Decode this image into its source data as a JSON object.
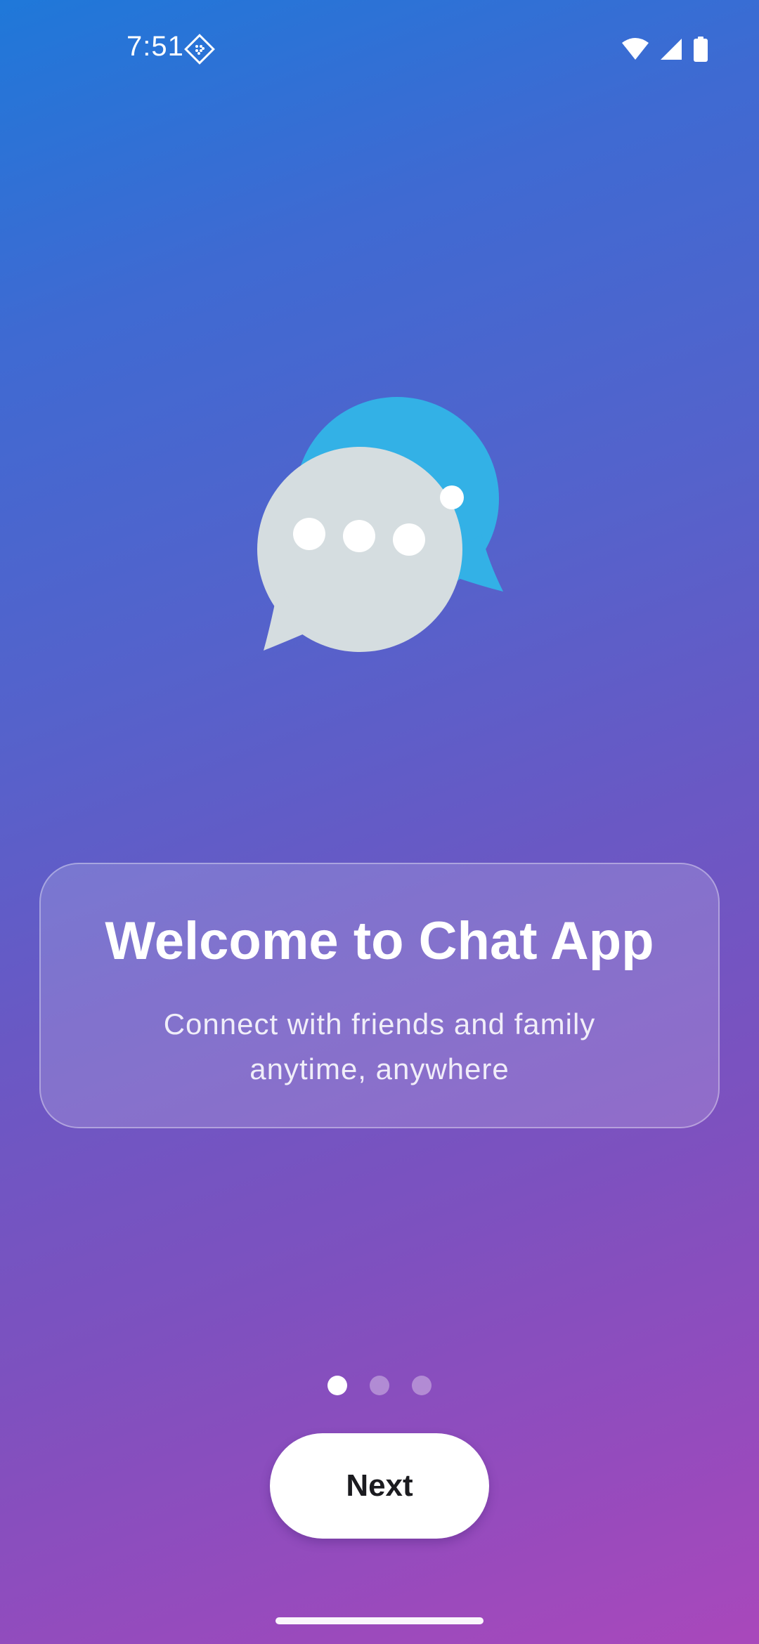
{
  "status_bar": {
    "time": "7:51",
    "icons": [
      "notification-diamond-icon",
      "wifi-icon",
      "cellular-signal-icon",
      "battery-icon"
    ]
  },
  "hero": {
    "icon": "chat-bubbles-icon",
    "colors": {
      "back_bubble": "#33b1e6",
      "front_bubble": "#d5dde0",
      "dots": "#ffffff"
    }
  },
  "welcome_card": {
    "title": "Welcome to Chat App",
    "subtitle": "Connect with friends and family anytime, anywhere"
  },
  "pagination": {
    "total": 3,
    "active_index": 0
  },
  "actions": {
    "next_label": "Next"
  },
  "colors": {
    "gradient_start": "#1f78d9",
    "gradient_end": "#a948bb",
    "button_background": "#ffffff",
    "button_text": "#1b1b1f"
  }
}
